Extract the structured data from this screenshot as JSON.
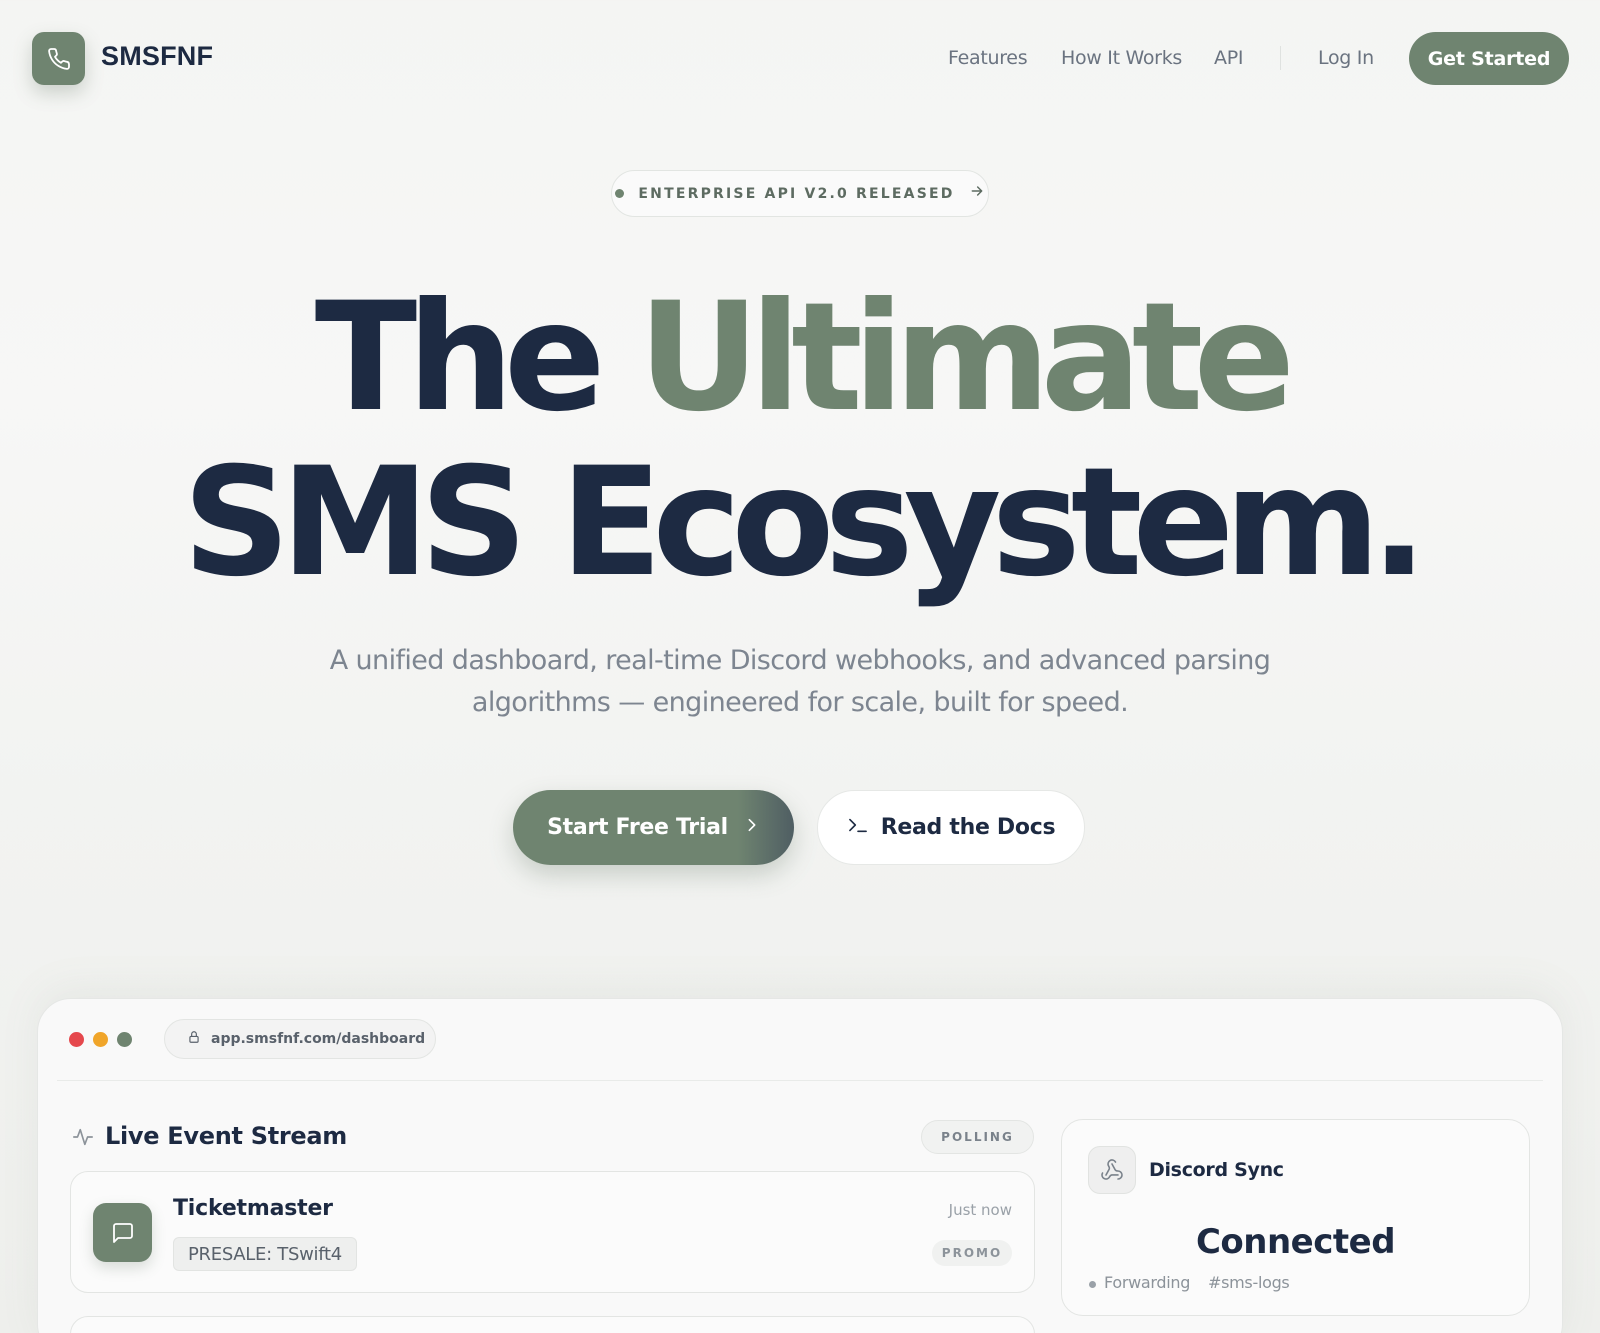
{
  "brand": {
    "name": "SMSFNF",
    "logo_icon": "phone-icon",
    "accent_color": "#6f8470",
    "dark_color": "#1d2a42"
  },
  "nav": {
    "links": [
      "Features",
      "How It Works",
      "API"
    ],
    "login": "Log In",
    "cta": "Get Started"
  },
  "badge": {
    "text": "ENTERPRISE API V2.0 RELEASED",
    "icon": "arrow-right-icon"
  },
  "hero": {
    "line1_dark": "The",
    "line1_accent": "Ultimate",
    "line2": "SMS Ecosystem.",
    "subtitle_line1": "A unified dashboard, real-time Discord webhooks, and advanced parsing",
    "subtitle_line2": "algorithms — engineered for scale, built for speed."
  },
  "buttons": {
    "primary": "Start Free Trial",
    "primary_icon": "chevron-right-icon",
    "secondary": "Read the Docs",
    "secondary_icon": "terminal-icon"
  },
  "dashboard": {
    "window_dots": [
      "#e5484d",
      "#f0a52a",
      "#6f8470"
    ],
    "url": "app.smsfnf.com/dashboard",
    "stream": {
      "title": "Live Event Stream",
      "status": "POLLING",
      "events": [
        {
          "sender": "Ticketmaster",
          "code": "PRESALE: TSwift4",
          "time": "Just now",
          "tag": "PROMO"
        }
      ]
    },
    "discord": {
      "title": "Discord Sync",
      "status": "Connected",
      "forwarding_label": "Forwarding",
      "channel": "#sms-logs"
    }
  }
}
